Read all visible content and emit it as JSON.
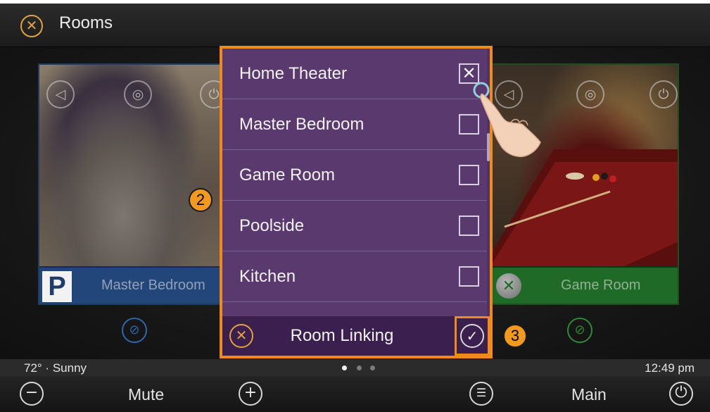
{
  "header": {
    "title": "Rooms",
    "close_icon": "close-circle-icon"
  },
  "cards": {
    "left": {
      "label": "Master Bedroom",
      "badge": "P",
      "source": "pandora"
    },
    "right": {
      "label": "Game Room",
      "badge": "",
      "source": "xbox"
    },
    "icons": {
      "mute": "◁",
      "light": "◎",
      "power": "⏻",
      "link": "⊘"
    }
  },
  "callouts": {
    "two": "2",
    "three": "3"
  },
  "modal": {
    "rooms": [
      {
        "label": "Home Theater",
        "checked": true,
        "mark": "✕"
      },
      {
        "label": "Master Bedroom",
        "checked": false,
        "mark": ""
      },
      {
        "label": "Game Room",
        "checked": false,
        "mark": ""
      },
      {
        "label": "Poolside",
        "checked": false,
        "mark": ""
      },
      {
        "label": "Kitchen",
        "checked": false,
        "mark": ""
      }
    ],
    "footer": {
      "title": "Room Linking",
      "cancel_glyph": "✕",
      "confirm_glyph": "✓"
    }
  },
  "status": {
    "weather": "72° · Sunny",
    "time": "12:49 pm",
    "pages": 3,
    "active_page": 1
  },
  "toolbar": {
    "minus_glyph": "−",
    "mute_label": "Mute",
    "plus_glyph": "+",
    "main_label": "Main",
    "power_glyph": "⏻"
  },
  "colors": {
    "accent": "#f08a1c",
    "modal_bg": "#5a3a6e",
    "modal_footer": "#3b1f4e",
    "left_card": "#22467a",
    "right_card": "#1e6a26",
    "header_icon": "#e2a33c"
  }
}
